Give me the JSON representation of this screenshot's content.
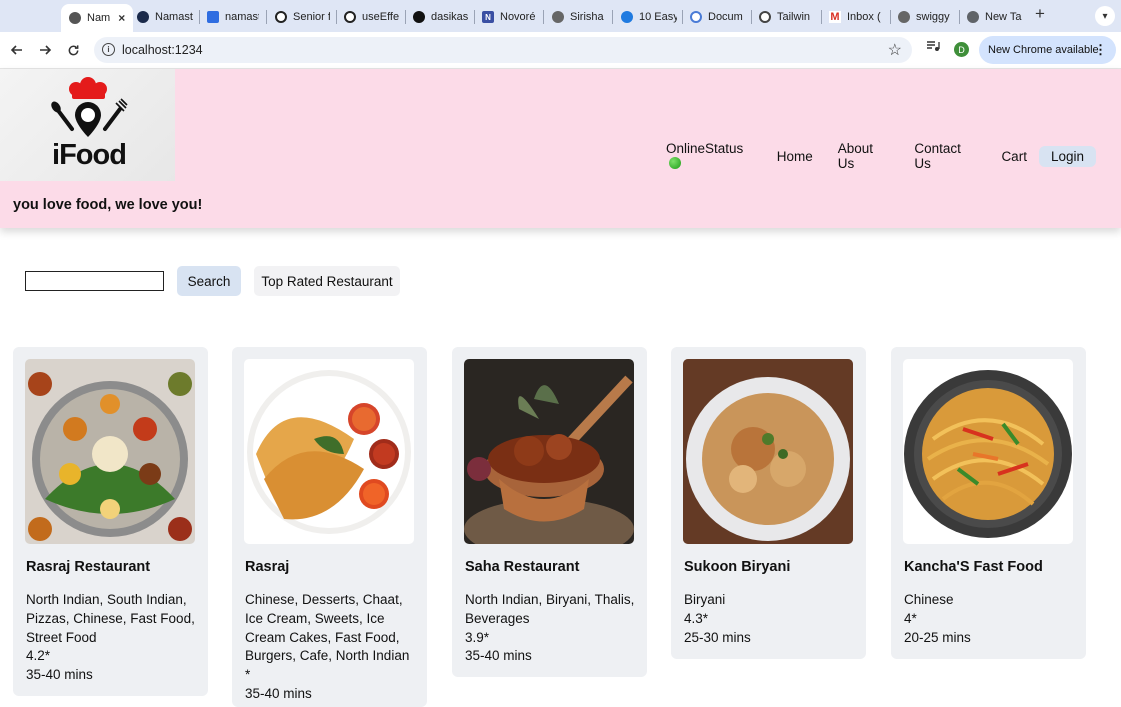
{
  "browser": {
    "tabs": [
      {
        "label": "Nam",
        "active": true
      },
      {
        "label": "Namast"
      },
      {
        "label": "namast"
      },
      {
        "label": "Senior f"
      },
      {
        "label": "useEffe"
      },
      {
        "label": "dasikas"
      },
      {
        "label": "Novoré"
      },
      {
        "label": "Sirisha"
      },
      {
        "label": "10 Easy"
      },
      {
        "label": "Docum"
      },
      {
        "label": "Tailwin"
      },
      {
        "label": "Inbox ("
      },
      {
        "label": "swiggy"
      },
      {
        "label": "New Ta"
      }
    ],
    "url": "localhost:1234",
    "profile_initial": "D",
    "update_label": "New Chrome available"
  },
  "header": {
    "logo_text": "iFood",
    "tagline": "you love food, we love you!",
    "nav": {
      "online_status": "OnlineStatus",
      "home": "Home",
      "about": "About Us",
      "contact": "Contact Us",
      "cart": "Cart",
      "login": "Login"
    }
  },
  "search": {
    "value": "",
    "button_label": "Search",
    "top_rated_label": "Top Rated Restaurant"
  },
  "restaurants": [
    {
      "name": "Rasraj Restaurant",
      "cuisines": "North Indian, South Indian, Pizzas, Chinese, Fast Food, Street Food",
      "rating": "4.2*",
      "time": "35-40 mins"
    },
    {
      "name": "Rasraj",
      "cuisines": "Chinese, Desserts, Chaat, Ice Cream, Sweets, Ice Cream Cakes, Fast Food, Burgers, Cafe, North Indian",
      "rating": "*",
      "time": "35-40 mins"
    },
    {
      "name": "Saha Restaurant",
      "cuisines": "North Indian, Biryani, Thalis, Beverages",
      "rating": "3.9*",
      "time": "35-40 mins"
    },
    {
      "name": "Sukoon Biryani",
      "cuisines": "Biryani",
      "rating": "4.3*",
      "time": "25-30 mins"
    },
    {
      "name": "Kancha'S Fast Food",
      "cuisines": "Chinese",
      "rating": "4*",
      "time": "20-25 mins"
    }
  ]
}
